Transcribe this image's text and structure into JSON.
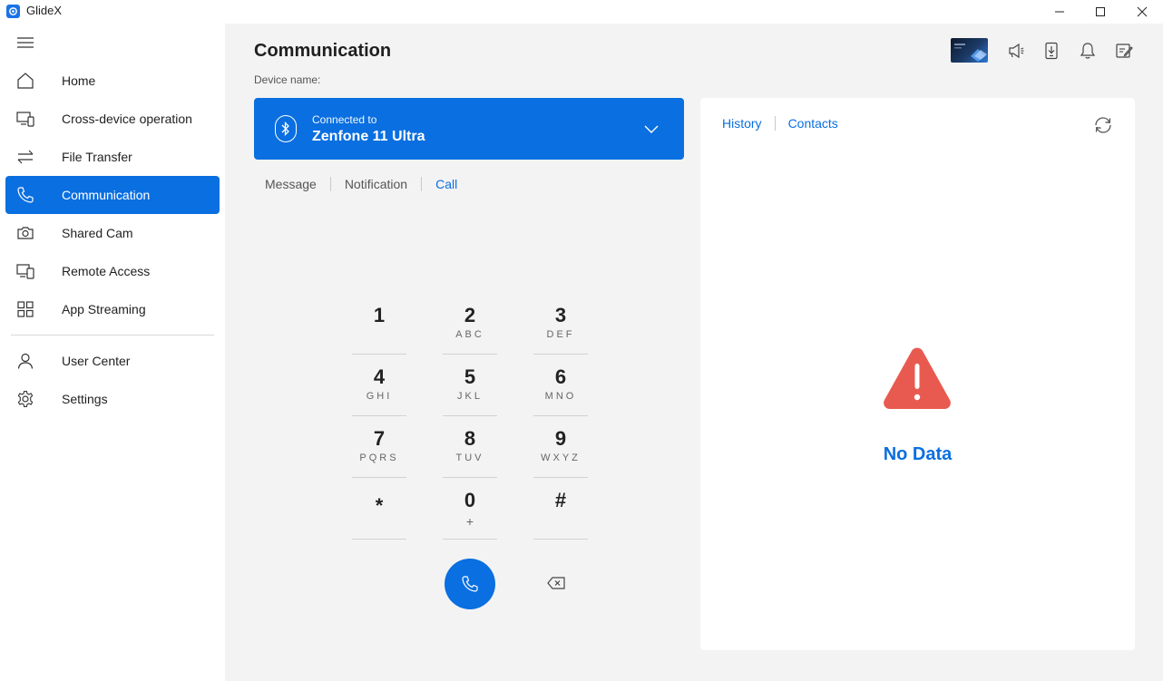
{
  "window": {
    "title": "GlideX",
    "minimize_icon": "minimize-icon",
    "maximize_icon": "maximize-icon",
    "close_icon": "close-icon"
  },
  "sidebar": {
    "menu_icon": "hamburger-icon",
    "items": [
      {
        "label": "Home",
        "icon": "home-icon"
      },
      {
        "label": "Cross-device operation",
        "icon": "cross-device-icon"
      },
      {
        "label": "File Transfer",
        "icon": "file-transfer-icon"
      },
      {
        "label": "Communication",
        "icon": "phone-icon",
        "active": true
      },
      {
        "label": "Shared Cam",
        "icon": "camera-icon"
      },
      {
        "label": "Remote Access",
        "icon": "remote-access-icon"
      },
      {
        "label": "App Streaming",
        "icon": "app-grid-icon"
      }
    ],
    "bottom_items": [
      {
        "label": "User Center",
        "icon": "user-icon"
      },
      {
        "label": "Settings",
        "icon": "gear-icon"
      }
    ]
  },
  "header": {
    "title": "Communication",
    "toolbar_icons": [
      "promo-thumbnail",
      "megaphone-icon",
      "device-download-icon",
      "bell-icon",
      "edit-note-icon"
    ]
  },
  "device": {
    "label": "Device name:",
    "status": "Connected to",
    "name": "Zenfone 11 Ultra",
    "icon": "bluetooth-icon"
  },
  "subtabs": [
    {
      "label": "Message"
    },
    {
      "label": "Notification"
    },
    {
      "label": "Call",
      "active": true
    }
  ],
  "dialpad": {
    "keys": [
      {
        "digit": "1",
        "letters": ""
      },
      {
        "digit": "2",
        "letters": "ABC"
      },
      {
        "digit": "3",
        "letters": "DEF"
      },
      {
        "digit": "4",
        "letters": "GHI"
      },
      {
        "digit": "5",
        "letters": "JKL"
      },
      {
        "digit": "6",
        "letters": "MNO"
      },
      {
        "digit": "7",
        "letters": "PQRS"
      },
      {
        "digit": "8",
        "letters": "TUV"
      },
      {
        "digit": "9",
        "letters": "WXYZ"
      },
      {
        "digit": "*",
        "letters": ""
      },
      {
        "digit": "0",
        "letters": "+"
      },
      {
        "digit": "#",
        "letters": ""
      }
    ],
    "call_icon": "phone-icon",
    "backspace_icon": "backspace-icon"
  },
  "panel": {
    "tabs": [
      {
        "label": "History"
      },
      {
        "label": "Contacts"
      }
    ],
    "refresh_icon": "refresh-icon",
    "empty_icon": "warning-icon",
    "empty_text": "No Data"
  },
  "colors": {
    "accent": "#0a6fe0",
    "warning": "#e85a4f",
    "background": "#f3f3f3"
  }
}
